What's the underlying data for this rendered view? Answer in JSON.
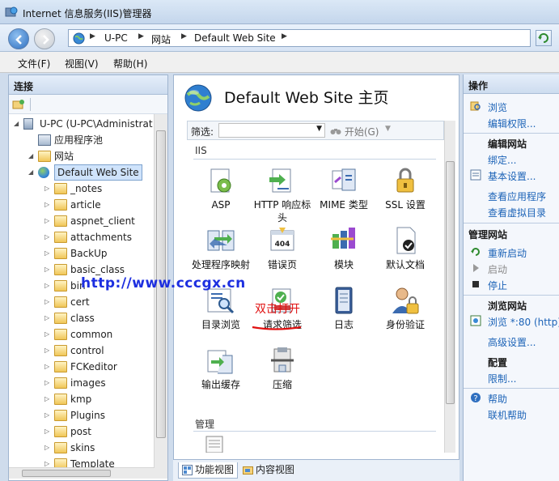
{
  "window": {
    "title": "Internet 信息服务(IIS)管理器"
  },
  "address": {
    "crumbs": [
      "U-PC",
      "网站",
      "Default Web Site"
    ]
  },
  "menu": {
    "file": "文件(F)",
    "view": "视图(V)",
    "help": "帮助(H)"
  },
  "connections": {
    "title": "连接",
    "tree": [
      {
        "label": "U-PC (U-PC\\Administrat",
        "level": 0,
        "icon": "server-icon"
      },
      {
        "label": "应用程序池",
        "level": 1,
        "icon": "app-pool-icon"
      },
      {
        "label": "网站",
        "level": 1,
        "icon": "sites-folder-icon"
      },
      {
        "label": "Default Web Site",
        "level": 2,
        "icon": "globe-icon",
        "selected": true
      },
      {
        "label": "_notes",
        "level": 3,
        "icon": "folder-icon"
      },
      {
        "label": "article",
        "level": 3,
        "icon": "folder-icon"
      },
      {
        "label": "aspnet_client",
        "level": 3,
        "icon": "folder-icon"
      },
      {
        "label": "attachments",
        "level": 3,
        "icon": "folder-icon"
      },
      {
        "label": "BackUp",
        "level": 3,
        "icon": "folder-icon"
      },
      {
        "label": "basic_class",
        "level": 3,
        "icon": "folder-icon"
      },
      {
        "label": "bin",
        "level": 3,
        "icon": "folder-icon"
      },
      {
        "label": "cert",
        "level": 3,
        "icon": "folder-icon"
      },
      {
        "label": "class",
        "level": 3,
        "icon": "folder-icon"
      },
      {
        "label": "common",
        "level": 3,
        "icon": "folder-icon"
      },
      {
        "label": "control",
        "level": 3,
        "icon": "folder-icon"
      },
      {
        "label": "FCKeditor",
        "level": 3,
        "icon": "folder-icon"
      },
      {
        "label": "images",
        "level": 3,
        "icon": "folder-icon"
      },
      {
        "label": "kmp",
        "level": 3,
        "icon": "folder-icon"
      },
      {
        "label": "Plugins",
        "level": 3,
        "icon": "folder-icon"
      },
      {
        "label": "post",
        "level": 3,
        "icon": "folder-icon"
      },
      {
        "label": "skins",
        "level": 3,
        "icon": "folder-icon"
      },
      {
        "label": "Template",
        "level": 3,
        "icon": "folder-icon"
      }
    ]
  },
  "center": {
    "title": "Default Web Site 主页",
    "filter": {
      "label": "筛选:",
      "go": "开始(G)"
    },
    "groups": [
      {
        "name": "IIS",
        "features": [
          {
            "label": "ASP",
            "icon": "asp-icon"
          },
          {
            "label": "HTTP 响应标头",
            "icon": "http-response-headers-icon"
          },
          {
            "label": "MIME 类型",
            "icon": "mime-types-icon"
          },
          {
            "label": "SSL 设置",
            "icon": "ssl-lock-icon"
          },
          {
            "label": "处理程序映射",
            "icon": "handler-mappings-icon"
          },
          {
            "label": "错误页",
            "icon": "error-pages-icon"
          },
          {
            "label": "模块",
            "icon": "modules-icon"
          },
          {
            "label": "默认文档",
            "icon": "default-document-icon"
          },
          {
            "label": "目录浏览",
            "icon": "directory-browsing-icon"
          },
          {
            "label": "请求筛选",
            "icon": "request-filtering-icon"
          },
          {
            "label": "日志",
            "icon": "logging-icon"
          },
          {
            "label": "身份验证",
            "icon": "authentication-icon"
          },
          {
            "label": "输出缓存",
            "icon": "output-caching-icon"
          },
          {
            "label": "压缩",
            "icon": "compression-icon"
          }
        ]
      },
      {
        "name": "管理",
        "features": []
      }
    ],
    "tabs": {
      "features_view": "功能视图",
      "content_view": "内容视图"
    }
  },
  "actions": {
    "title": "操作",
    "browse": "浏览",
    "edit_permissions": "编辑权限...",
    "edit_site_h": "编辑网站",
    "bindings": "绑定...",
    "basic_settings": "基本设置...",
    "view_apps": "查看应用程序",
    "view_vdirs": "查看虚拟目录",
    "manage_site_h": "管理网站",
    "restart": "重新启动",
    "start": "启动",
    "stop": "停止",
    "browse_site_h": "浏览网站",
    "browse_80": "浏览 *:80 (http)",
    "advanced_settings": "高级设置...",
    "config_h": "配置",
    "limits": "限制...",
    "help": "帮助",
    "online_help": "联机帮助"
  },
  "overlay": {
    "watermark": "http://www.cccgx.cn",
    "annotation": "双击打开",
    "annotation_color": "#e01010"
  }
}
